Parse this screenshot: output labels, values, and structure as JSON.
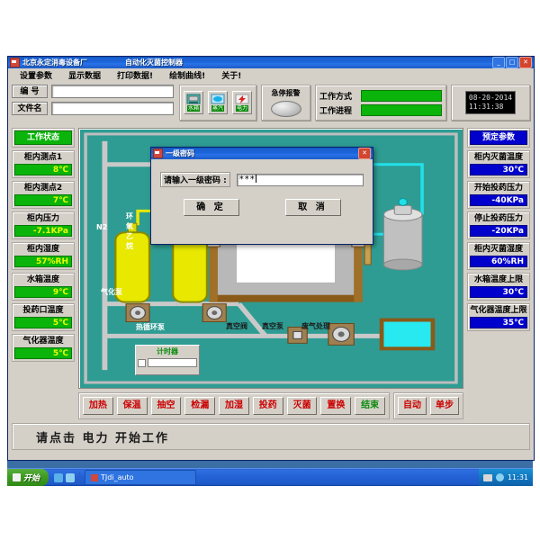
{
  "window": {
    "title": "北京永定消毒设备厂",
    "subtitle": "自动化灭菌控制器",
    "minimize": "_",
    "maximize": "□",
    "close": "✕",
    "icon": "app-icon"
  },
  "menu": [
    {
      "label": "设置参数"
    },
    {
      "label": "显示数据"
    },
    {
      "label": "打印数据!"
    },
    {
      "label": "绘制曲线!"
    },
    {
      "label": "关于!"
    }
  ],
  "header": {
    "id_label": "编  号",
    "id_value": "",
    "file_label": "文件名",
    "file_value": "",
    "icon_buttons": [
      {
        "label": "水箱",
        "icon": "water-tank-icon"
      },
      {
        "label": "蒸汽",
        "icon": "steam-icon"
      },
      {
        "label": "电力",
        "icon": "power-icon"
      }
    ],
    "estop_label": "急停报警",
    "estop_led": "estop-lamp",
    "mode_label": "工作方式",
    "progress_label": "工作进程",
    "mode_bar_color": "#0ab40a",
    "clock_date": "08-20-2014",
    "clock_time": "11:31:38"
  },
  "left_panel": {
    "header": "工作状态",
    "items": [
      {
        "title": "柜内测点1",
        "value": "8℃"
      },
      {
        "title": "柜内测点2",
        "value": "7℃"
      },
      {
        "title": "柜内压力",
        "value": "-7.1KPa"
      },
      {
        "title": "柜内湿度",
        "value": "57%RH"
      },
      {
        "title": "水箱温度",
        "value": "9℃"
      },
      {
        "title": "投药口温度",
        "value": "5℃"
      },
      {
        "title": "气化器温度",
        "value": "5℃"
      }
    ]
  },
  "right_panel": {
    "header": "预定参数",
    "items": [
      {
        "title": "柜内灭菌温度",
        "value": "30℃"
      },
      {
        "title": "开始投药压力",
        "value": "-40KPa"
      },
      {
        "title": "停止投药压力",
        "value": "-20KPa"
      },
      {
        "title": "柜内灭菌湿度",
        "value": "60%RH"
      },
      {
        "title": "水箱温度上限",
        "value": "30℃"
      },
      {
        "title": "气化器温度上限",
        "value": "35℃"
      }
    ]
  },
  "mimic": {
    "cylinder1_label": "N2",
    "cylinder2_label": "环氧乙烷",
    "pump1_label": "气化泵",
    "pump2_label": "热循环泵",
    "valve_label": "真空阀",
    "vacuum_pump_label": "真空泵",
    "exhaust_label": "废气处理",
    "timer_title": "计时器",
    "timer_value": "",
    "timer_checked": false,
    "bg_color": "#2e9c93",
    "pipe_color": "#c9c9c9",
    "hot_pipe_color": "#e8e800",
    "cold_pipe_color": "#22e0e8"
  },
  "operations": {
    "buttons": [
      {
        "label": "加热",
        "color": "red"
      },
      {
        "label": "保温",
        "color": "red"
      },
      {
        "label": "抽空",
        "color": "red"
      },
      {
        "label": "检漏",
        "color": "red"
      },
      {
        "label": "加湿",
        "color": "red"
      },
      {
        "label": "投药",
        "color": "red"
      },
      {
        "label": "灭菌",
        "color": "red"
      },
      {
        "label": "置换",
        "color": "red"
      },
      {
        "label": "结束",
        "color": "green"
      }
    ],
    "mode_buttons": [
      {
        "label": "自动",
        "color": "red"
      },
      {
        "label": "单步",
        "color": "red"
      }
    ]
  },
  "status_bar": {
    "text": "请点击  电力  开始工作"
  },
  "dialog": {
    "title": "一级密码",
    "close": "✕",
    "prompt": "请输入一级密码 :",
    "password_value": "***",
    "ok_label": "确 定",
    "cancel_label": "取 消",
    "icon": "dialog-icon"
  },
  "taskbar": {
    "start_label": "开始",
    "task_label": "TJdi_auto",
    "tray_time": "11:31"
  }
}
